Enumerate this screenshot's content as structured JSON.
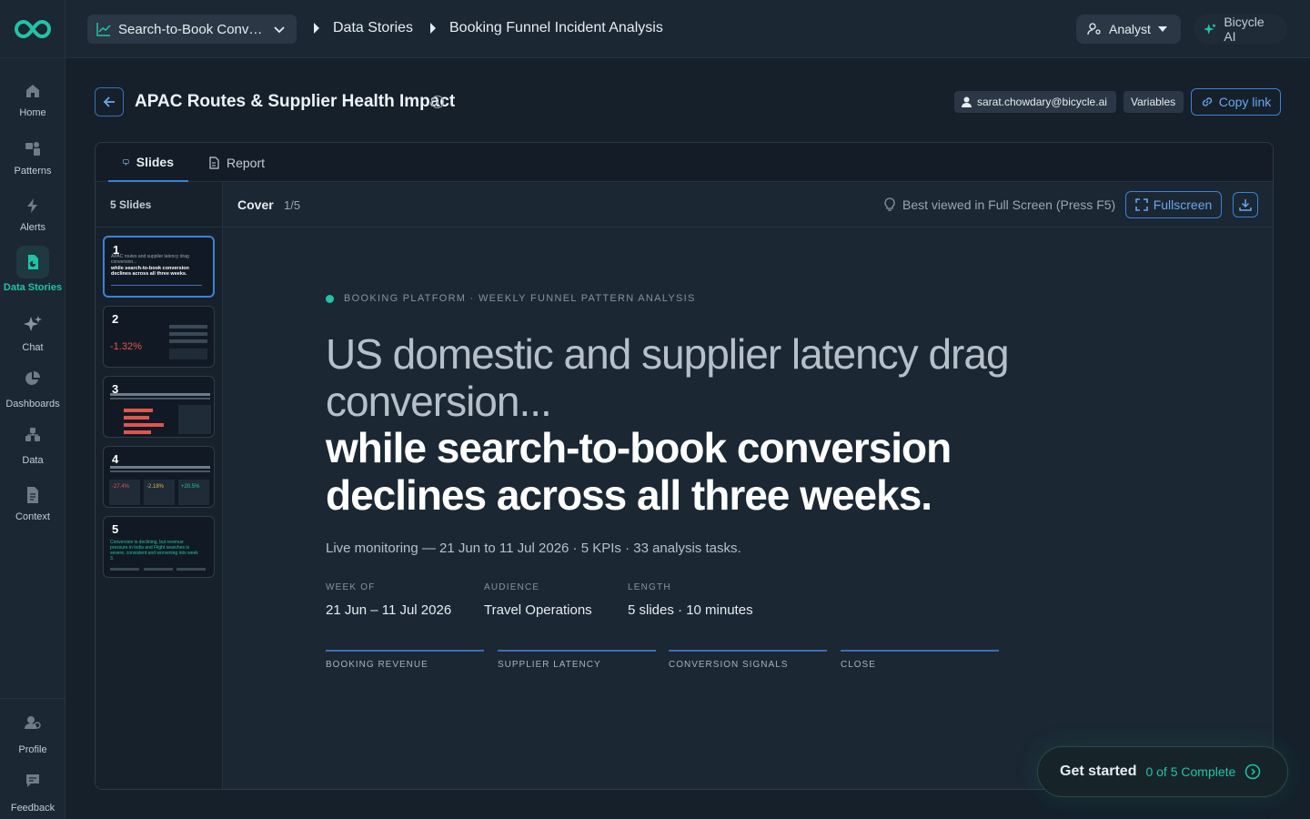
{
  "app": {
    "brand_color": "#22c3a6",
    "accent": "#3b82d6"
  },
  "rail": {
    "items": [
      {
        "label": "Home",
        "icon": "home-icon"
      },
      {
        "label": "Patterns",
        "icon": "patterns-icon"
      },
      {
        "label": "Alerts",
        "icon": "bolt-icon"
      },
      {
        "label": "Data Stories",
        "icon": "data-stories-icon",
        "active": true
      },
      {
        "label": "Chat",
        "icon": "sparkles-icon"
      },
      {
        "label": "Dashboards",
        "icon": "pie-chart-icon"
      },
      {
        "label": "Data",
        "icon": "data-icon"
      },
      {
        "label": "Context",
        "icon": "document-icon"
      }
    ],
    "bottom": [
      {
        "label": "Profile",
        "icon": "profile-icon"
      },
      {
        "label": "Feedback",
        "icon": "feedback-icon"
      }
    ]
  },
  "topbar": {
    "selector": "Search-to-Book Conversion Funnel",
    "breadcrumbs": [
      "Data Stories",
      "Booking Funnel Incident Analysis"
    ],
    "role": "Analyst",
    "ai": "Bicycle AI"
  },
  "header": {
    "title": "APAC Routes & Supplier Health Impact",
    "user": "sarat.chowdary@bicycle.ai",
    "variables": "Variables",
    "copy_link": "Copy link"
  },
  "tabs": [
    {
      "label": "Slides",
      "active": true
    },
    {
      "label": "Report",
      "active": false
    }
  ],
  "slides_panel": {
    "count": "5 Slides",
    "numbers": [
      "1",
      "2",
      "3",
      "4",
      "5"
    ]
  },
  "viewer": {
    "title": "Cover",
    "counter": "1/5",
    "hint": "Best viewed in Full Screen (Press F5)",
    "fullscreen": "Fullscreen"
  },
  "slide": {
    "eyebrow": "BOOKING PLATFORM · WEEKLY FUNNEL PATTERN ANALYSIS",
    "headline_light": "US domestic and supplier latency drag conversion...",
    "headline_bold": "while search-to-book conversion declines across all three weeks.",
    "subline": "Live monitoring — 21 Jun to 11 Jul 2026 · 5 KPIs · 33 analysis tasks.",
    "meta": [
      {
        "key": "WEEK OF",
        "value": "21 Jun – 11 Jul 2026"
      },
      {
        "key": "AUDIENCE",
        "value": "Travel Operations"
      },
      {
        "key": "LENGTH",
        "value": "5 slides · 10 minutes"
      }
    ],
    "sections": [
      "BOOKING REVENUE",
      "SUPPLIER LATENCY",
      "CONVERSION SIGNALS",
      "CLOSE"
    ]
  },
  "thumbs": {
    "t1_light": "APAC routes and supplier latency drag conversion...",
    "t1_bold": "while search-to-book conversion declines across all three weeks.",
    "t2_value": "-1.32%",
    "t4_values": [
      "-27.4%",
      "-2.18%",
      "+20.5%"
    ],
    "t5_text": "Conversion is declining, but revenue pressure in India and Flight searches is severe, consistent and worsening into week 3."
  },
  "get_started": {
    "title": "Get started",
    "progress": "0 of 5 Complete"
  }
}
